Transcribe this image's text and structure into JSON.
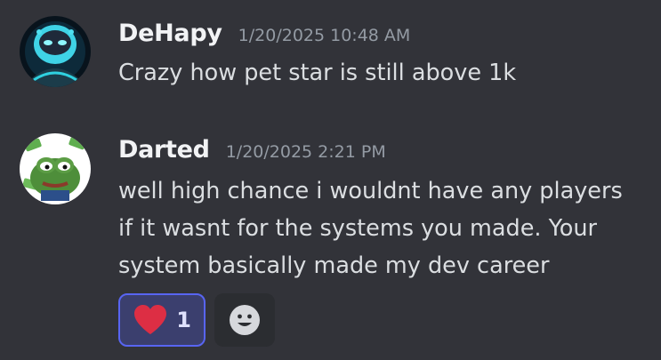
{
  "messages": [
    {
      "username": "DeHapy",
      "timestamp": "1/20/2025 10:48 AM",
      "lines": [
        "Crazy how pet star is still above 1k"
      ],
      "avatar_icon": "masked-character-avatar"
    },
    {
      "username": "Darted",
      "timestamp": "1/20/2025 2:21 PM",
      "lines": [
        "well high chance i wouldnt have any players",
        "if it wasnt for the systems you made. Your",
        "system basically made my dev career"
      ],
      "avatar_icon": "pepe-frog-money-avatar"
    }
  ],
  "reactions": [
    {
      "emoji_icon": "red-heart-icon",
      "count": "1",
      "active": true
    }
  ],
  "add_reaction_icon": "smiley-add-reaction-icon",
  "colors": {
    "background": "#323339",
    "username": "#f2f3f5",
    "timestamp": "#949ba4",
    "text": "#dbdee1",
    "reaction_active_bg": "#3b3f6e",
    "reaction_active_border": "#5865f2",
    "heart": "#dd2e44"
  }
}
